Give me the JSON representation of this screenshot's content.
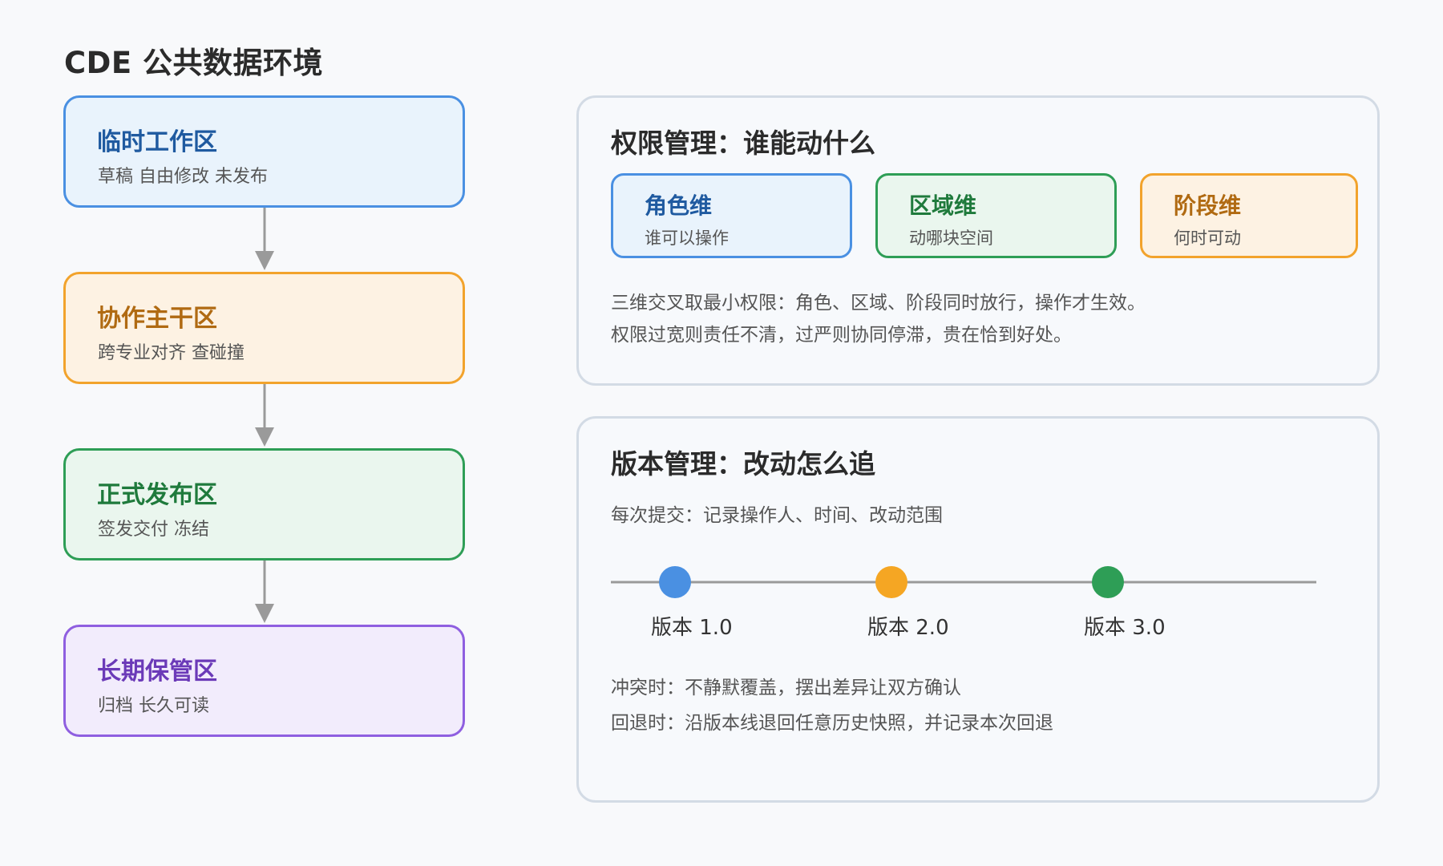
{
  "title": "CDE 公共数据环境",
  "zones": [
    {
      "title": "临时工作区",
      "desc": "草稿 自由修改 未发布"
    },
    {
      "title": "协作主干区",
      "desc": "跨专业对齐 查碰撞"
    },
    {
      "title": "正式发布区",
      "desc": "签发交付 冻结"
    },
    {
      "title": "长期保管区",
      "desc": "归档 长久可读"
    }
  ],
  "permission": {
    "title": "权限管理：谁能动什么",
    "dimensions": [
      {
        "title": "角色维",
        "desc": "谁可以操作"
      },
      {
        "title": "区域维",
        "desc": "动哪块空间"
      },
      {
        "title": "阶段维",
        "desc": "何时可动"
      }
    ],
    "notes": [
      "三维交叉取最小权限：角色、区域、阶段同时放行，操作才生效。",
      "权限过宽则责任不清，过严则协同停滞，贵在恰到好处。"
    ]
  },
  "version": {
    "title": "版本管理：改动怎么追",
    "commit_note": "每次提交：记录操作人、时间、改动范围",
    "versions": [
      {
        "label": "版本 1.0",
        "color": "#4a90e2"
      },
      {
        "label": "版本 2.0",
        "color": "#f5a623"
      },
      {
        "label": "版本 3.0",
        "color": "#2e9e56"
      }
    ],
    "notes": [
      "冲突时：不静默覆盖，摆出差异让双方确认",
      "回退时：沿版本线退回任意历史快照，并记录本次回退"
    ]
  }
}
